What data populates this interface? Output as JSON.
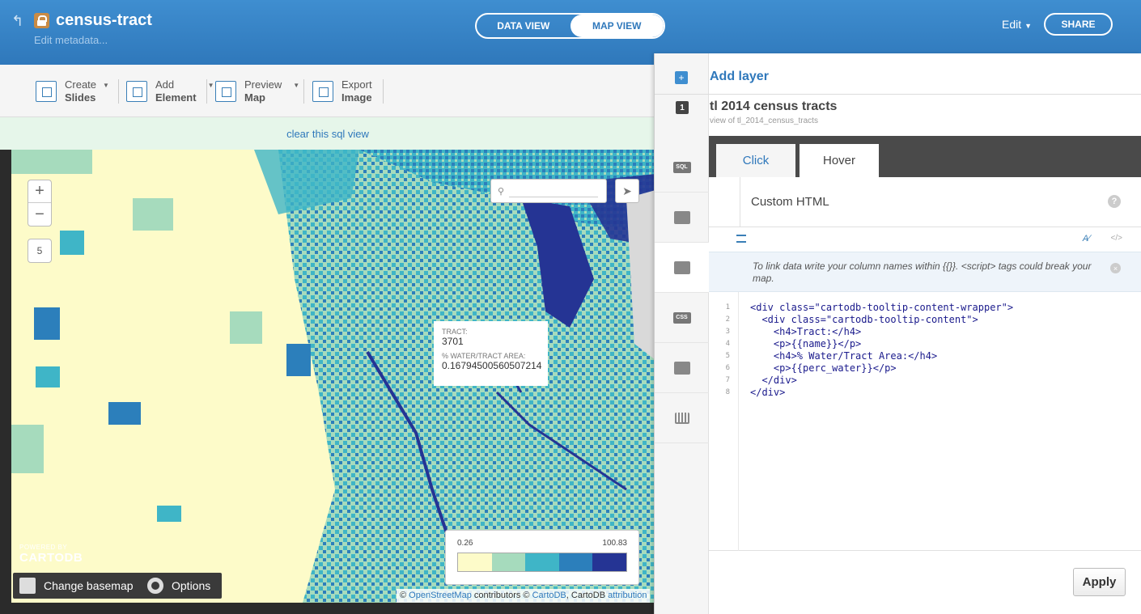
{
  "header": {
    "title": "census-tract",
    "subtitle": "Edit metadata...",
    "view_toggle": {
      "data_view": "DATA VIEW",
      "map_view": "MAP VIEW"
    },
    "edit_label": "Edit",
    "share_label": "SHARE"
  },
  "toolbar": {
    "create_top": "Create",
    "create_bottom": "Slides",
    "add_top": "Add",
    "add_bottom": "Element",
    "preview_top": "Preview",
    "preview_bottom": "Map",
    "export_top": "Export",
    "export_bottom": "Image"
  },
  "sql_bar": {
    "label": "clear this sql view"
  },
  "map": {
    "zoom_in": "+",
    "zoom_out": "−",
    "zoom_level": "5",
    "search_placeholder": "",
    "tooltip": {
      "tract_header": "TRACT:",
      "tract_value": "3701",
      "water_header": "% WATER/TRACT AREA:",
      "water_value": "0.16794500560507214"
    },
    "legend": {
      "min": "0.26",
      "max": "100.83",
      "colors": [
        "#fdfbc9",
        "#a6dbbd",
        "#3fb5c7",
        "#2c7fbb",
        "#253494"
      ]
    },
    "logo_small": "POWERED BY",
    "logo_text": "CARTODB",
    "change_basemap": "Change basemap",
    "options": "Options",
    "attribution": {
      "copy1": "©",
      "osm": "OpenStreetMap",
      "contributors": "contributors ©",
      "cartodb": "CartoDB",
      "comma": ", CartoDB",
      "attribution": "attribution"
    }
  },
  "panel": {
    "add_layer": "Add layer",
    "add_icon": "+",
    "layer_number": "1",
    "layer_name": "tl 2014 census tracts",
    "layer_sub": "view of tl_2014_census_tracts",
    "rail_sql": "SQL",
    "rail_css": "CSS",
    "tabs": {
      "click": "Click",
      "hover": "Hover"
    },
    "custom_html": "Custom HTML",
    "help": "?",
    "info_note": "To link data write your column names within {{}}. <script> tags could break your map.",
    "close": "×",
    "code_lines": [
      {
        "n": "1",
        "text": "<div class=\"cartodb-tooltip-content-wrapper\">"
      },
      {
        "n": "2",
        "text": "  <div class=\"cartodb-tooltip-content\">"
      },
      {
        "n": "3",
        "text": "    <h4>Tract:</h4>"
      },
      {
        "n": "4",
        "text": "    <p>{{name}}</p>"
      },
      {
        "n": "5",
        "text": "    <h4>% Water/Tract Area:</h4>"
      },
      {
        "n": "6",
        "text": "    <p>{{perc_water}}</p>"
      },
      {
        "n": "7",
        "text": "  </div>"
      },
      {
        "n": "8",
        "text": "</div>"
      }
    ],
    "apply": "Apply"
  },
  "colors": {
    "header_blue": "#2f78bb",
    "accent_blue": "#3f8ed0",
    "sql_bar_green": "#e6f6ea"
  }
}
